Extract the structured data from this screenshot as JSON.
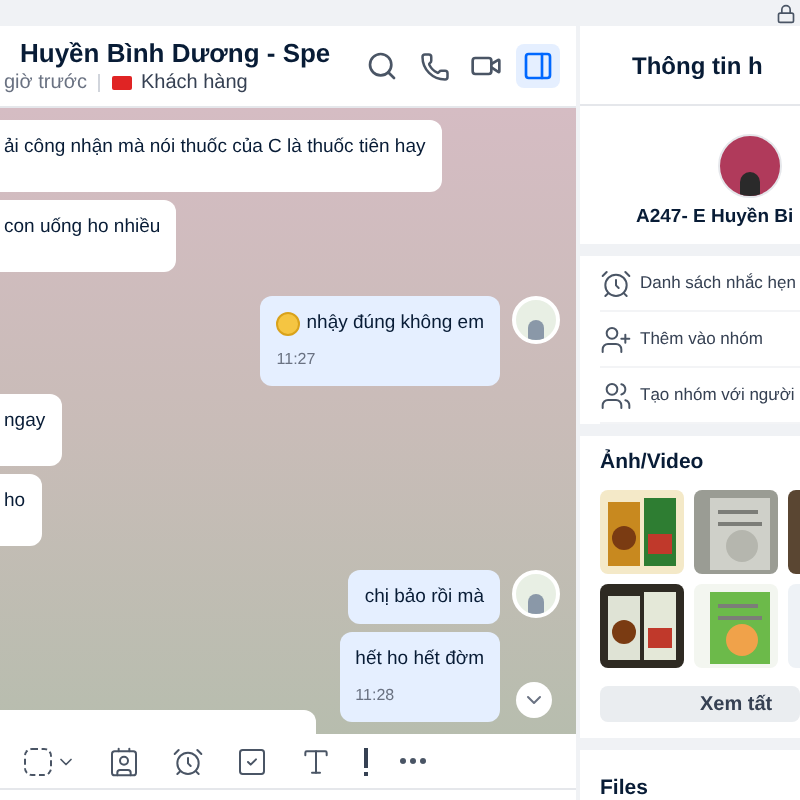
{
  "header": {
    "title": "Huyền Bình Dương - Spe",
    "last_seen": "giờ trước",
    "tag": {
      "label": "Khách hàng",
      "color": "#e02424"
    },
    "tools": [
      {
        "kind": "search",
        "selected": false
      },
      {
        "kind": "phone",
        "selected": false
      },
      {
        "kind": "video",
        "selected": false
      },
      {
        "kind": "panel",
        "selected": true
      }
    ]
  },
  "messages": [
    {
      "kind": "incoming",
      "text": "ải công nhận mà nói thuốc của C là thuốc tiên hay"
    },
    {
      "kind": "incoming",
      "text": "con uống ho nhiều"
    },
    {
      "kind": "outgoing",
      "text": "nhậy đúng không em",
      "emoji": true,
      "time": "11:27",
      "avatar": true
    },
    {
      "kind": "incoming",
      "text": "ngay"
    },
    {
      "kind": "incoming",
      "text": "ho"
    },
    {
      "kind": "outgoing",
      "text": "chị bảo rồi mà",
      "avatar": true
    },
    {
      "kind": "outgoing",
      "text": "hết ho hết đờm",
      "time": "11:28"
    }
  ],
  "composer_tools": [
    {
      "kind": "sticker"
    },
    {
      "kind": "card"
    },
    {
      "kind": "alarm"
    },
    {
      "kind": "task"
    },
    {
      "kind": "format"
    },
    {
      "kind": "urgent"
    },
    {
      "kind": "more"
    }
  ],
  "info_panel": {
    "title": "Thông tin h",
    "name": "A247- E Huyền Bi",
    "actions": [
      {
        "kind": "reminder",
        "label": "Danh sách nhắc hẹn"
      },
      {
        "kind": "add-group",
        "label": "Thêm vào nhóm"
      },
      {
        "kind": "new-group",
        "label": "Tạo nhóm với người"
      }
    ],
    "media_title": "Ảnh/Video",
    "see_all": "Xem tất",
    "files_title": "Files"
  }
}
